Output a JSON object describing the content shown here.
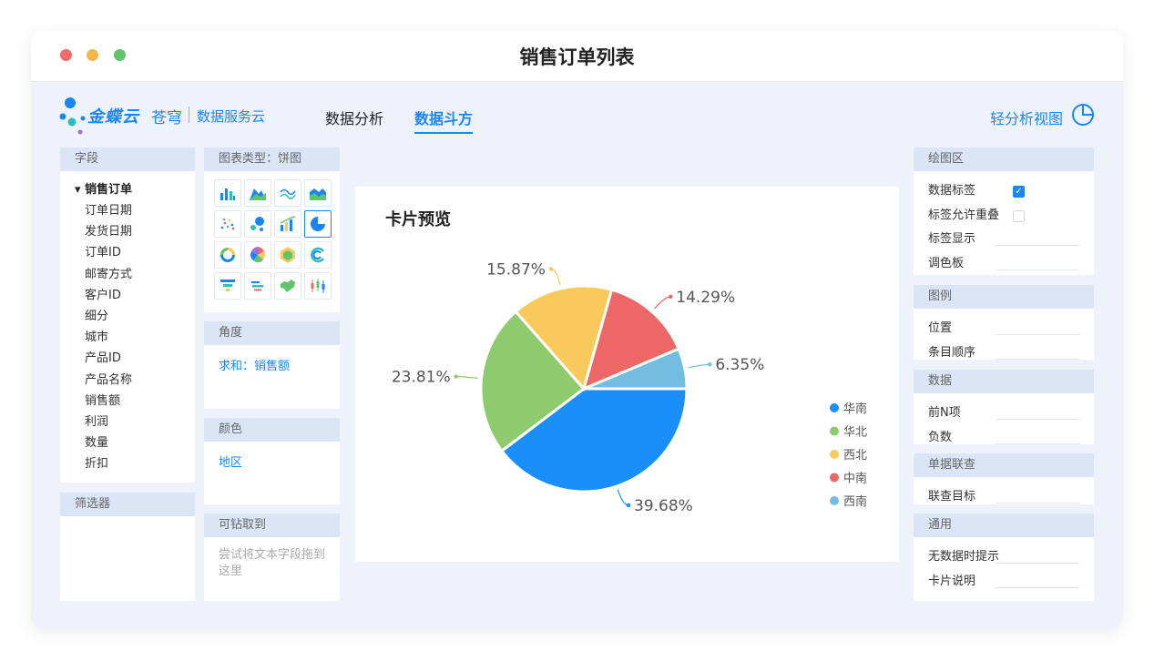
{
  "window": {
    "title": "销售订单列表"
  },
  "header": {
    "brand_name": "金蝶云",
    "brand_sub": "苍穹",
    "brand_cloud": "数据服务云",
    "nav": [
      "数据分析",
      "数据斗方"
    ],
    "view_link": "轻分析视图"
  },
  "fields": {
    "title": "字段",
    "root": "▾ 销售订单",
    "items": [
      "订单日期",
      "发货日期",
      "订单ID",
      "邮寄方式",
      "客户ID",
      "细分",
      "城市",
      "产品ID",
      "产品名称",
      "销售额",
      "利润",
      "数量",
      "折扣"
    ]
  },
  "filter": {
    "title": "筛选器"
  },
  "chart_type": {
    "title": "图表类型：饼图"
  },
  "angle": {
    "title": "角度",
    "value": "求和：销售额"
  },
  "color": {
    "title": "颜色",
    "value": "地区"
  },
  "drill": {
    "title": "可钻取到",
    "hint": "尝试将文本字段拖到这里"
  },
  "card": {
    "title": "卡片预览"
  },
  "right_panel": {
    "plot_area": {
      "title": "绘图区",
      "rows": [
        "数据标签",
        "标签允许重叠",
        "标签显示",
        "调色板"
      ],
      "data_label_checked": true,
      "overlap_checked": false
    },
    "legend": {
      "title": "图例",
      "rows": [
        "位置",
        "条目顺序"
      ]
    },
    "data": {
      "title": "数据",
      "rows": [
        "前N项",
        "负数"
      ]
    },
    "drill_link": {
      "title": "单据联查",
      "rows": [
        "联查目标"
      ]
    },
    "general": {
      "title": "通用",
      "rows": [
        "无数据时提示",
        "卡片说明"
      ]
    }
  },
  "colors": {
    "accent": "#1a86f6"
  },
  "chart_data": {
    "type": "pie",
    "categories": [
      "华南",
      "华北",
      "西北",
      "中南",
      "西南"
    ],
    "values": [
      39.68,
      23.81,
      15.87,
      14.29,
      6.35
    ],
    "labels": [
      "39.68%",
      "23.81%",
      "15.87%",
      "14.29%",
      "6.35%"
    ],
    "colors": [
      "#1a8ffa",
      "#8ecb6e",
      "#f8c95b",
      "#ee6767",
      "#74bde0"
    ],
    "legend": "right"
  }
}
